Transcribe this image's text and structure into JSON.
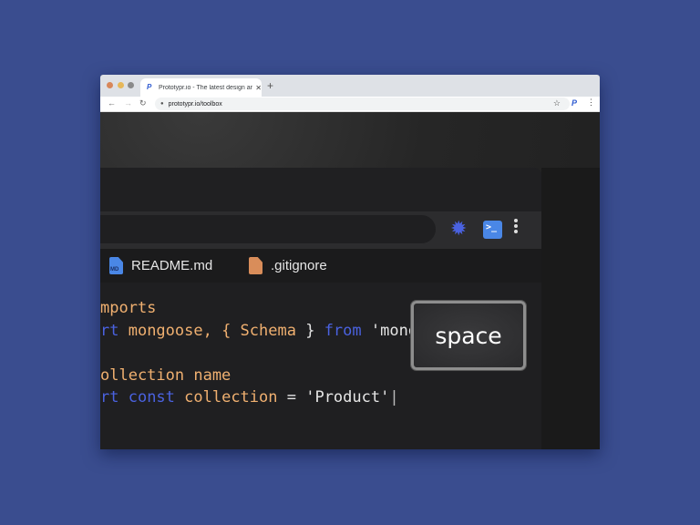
{
  "browser": {
    "tab": {
      "title": "Prototypr.io - The latest design ar",
      "favicon": "P",
      "close": "✕"
    },
    "new_tab": "+",
    "nav": {
      "back": "←",
      "forward": "→",
      "reload": "↻"
    },
    "url": "prototypr.io/toolbox",
    "lock_icon": "🔒",
    "bookmark_icon": "☆",
    "extension_icon": "P",
    "menu_icon": "⋮"
  },
  "editor": {
    "toolbar": {
      "sun_icon": "✹",
      "terminal_icon": ">_"
    },
    "files": [
      {
        "name": "README.md",
        "icon": "md-file-icon",
        "badge": "MD",
        "color": "#4a87e6"
      },
      {
        "name": ".gitignore",
        "icon": "file-icon",
        "color": "#d98d5a"
      }
    ],
    "code": {
      "line1": "mports",
      "line2": {
        "kw1": "rt",
        "t1": " mongoose, { ",
        "schema": "Schema",
        "t2": " } ",
        "from": "from",
        "str": " 'mongoose'"
      },
      "line4": "ollection name",
      "line5": {
        "kw1": "rt",
        "kw2": " const",
        "var": " collection",
        "eq": " = ",
        "str": "'Product'",
        "caret": "|"
      }
    }
  },
  "keycap": {
    "label": "space"
  },
  "colors": {
    "background": "#3a4d8f",
    "keyword": "#4a62e0",
    "identifier": "#f0b070",
    "terminal": "#4a87e6"
  }
}
